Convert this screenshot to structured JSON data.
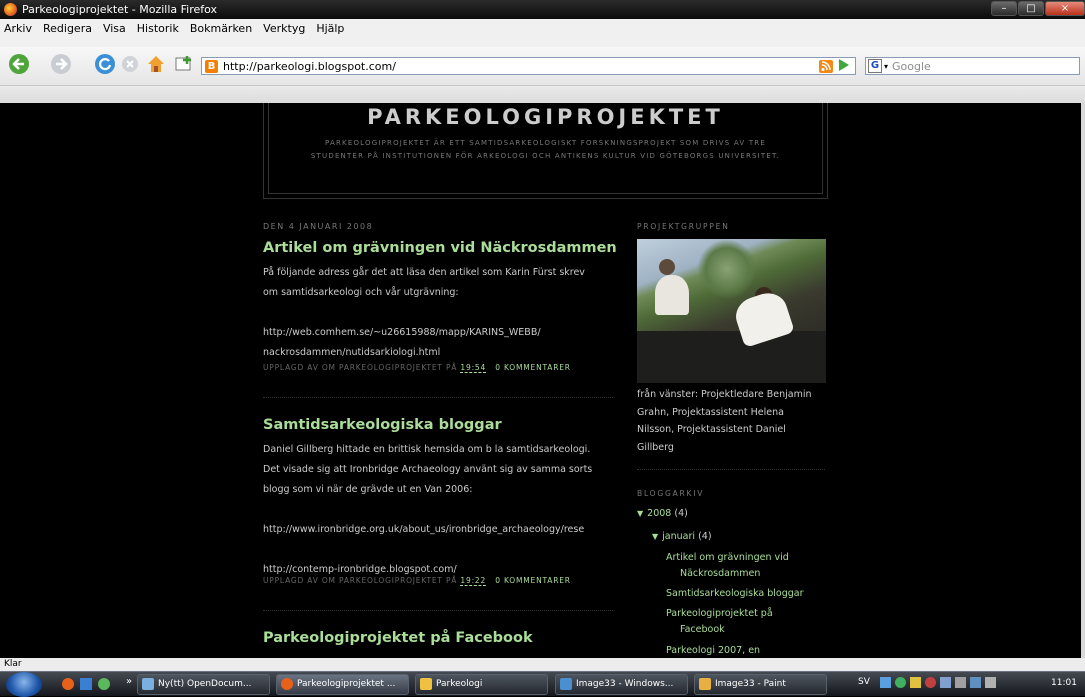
{
  "window": {
    "title": "Parkeologiprojektet - Mozilla Firefox"
  },
  "menu": [
    "Arkiv",
    "Redigera",
    "Visa",
    "Historik",
    "Bokmärken",
    "Verktyg",
    "Hjälp"
  ],
  "nav": {
    "url": "http://parkeologi.blogspot.com/",
    "search_placeholder": "Google"
  },
  "blog": {
    "title": "PARKEOLOGIPROJEKTET",
    "description": "PARKEOLOGIPROJEKTET ÄR ETT SAMTIDSARKEOLOGISKT FORSKNINGSPROJEKT SOM DRIVS AV TRE STUDENTER PÅ INSTITUTIONEN FÖR ARKEOLOGI OCH ANTIKENS KULTUR VID GÖTEBORGS UNIVERSITET."
  },
  "posts": [
    {
      "date": "DEN 4 JANUARI 2008",
      "title": "Artikel om grävningen vid Näckrosdammen",
      "lines": [
        "På följande adress går det att läsa den artikel som Karin Fürst skrev",
        "om samtidsarkeologi och vår utgrävning:",
        "",
        "http://web.comhem.se/~u26615988/mapp/KARINS_WEBB/",
        "nackrosdammen/nutidsarkiologi.html"
      ],
      "footer": "UPPLAGD AV OM PARKEOLOGIPROJEKTET PÅ",
      "time": "19:54",
      "comments": "0 KOMMENTARER"
    },
    {
      "title": "Samtidsarkeologiska bloggar",
      "lines": [
        "Daniel Gillberg hittade en brittisk hemsida om b la samtidsarkeologi.",
        "Det visade sig att Ironbridge Archaeology använt sig av samma sorts",
        "blogg som vi när de grävde ut en Van 2006:",
        "",
        "http://www.ironbridge.org.uk/about_us/ironbridge_archaeology/rese",
        "",
        "http://contemp-ironbridge.blogspot.com/"
      ],
      "footer": "UPPLAGD AV OM PARKEOLOGIPROJEKTET PÅ",
      "time": "19:22",
      "comments": "0 KOMMENTARER"
    },
    {
      "title": "Parkeologiprojektet på Facebook"
    }
  ],
  "sidebar": {
    "group_heading": "PROJEKTGRUPPEN",
    "caption": [
      "från vänster: Projektledare Benjamin",
      "Grahn, Projektassistent Helena",
      "Nilsson, Projektassistent Daniel",
      "Gillberg"
    ],
    "archive_heading": "BLOGGARKIV",
    "year": {
      "label": "2008",
      "count": "(4)"
    },
    "month": {
      "label": "januari",
      "count": "(4)"
    },
    "archive_posts": [
      [
        "Artikel om grävningen vid",
        "Näckrosdammen"
      ],
      [
        "Samtidsarkeologiska bloggar"
      ],
      [
        "Parkeologiprojektet på",
        "Facebook"
      ],
      [
        "Parkeologi 2007, en"
      ]
    ]
  },
  "status": {
    "text": "Klar"
  },
  "taskbar": {
    "items": [
      "Ny(tt) OpenDocum...",
      "Parkeologiprojektet ...",
      "Parkeologi",
      "Image33 - Windows...",
      "Image33 - Paint"
    ],
    "lang": "SV",
    "clock": "11:01"
  }
}
